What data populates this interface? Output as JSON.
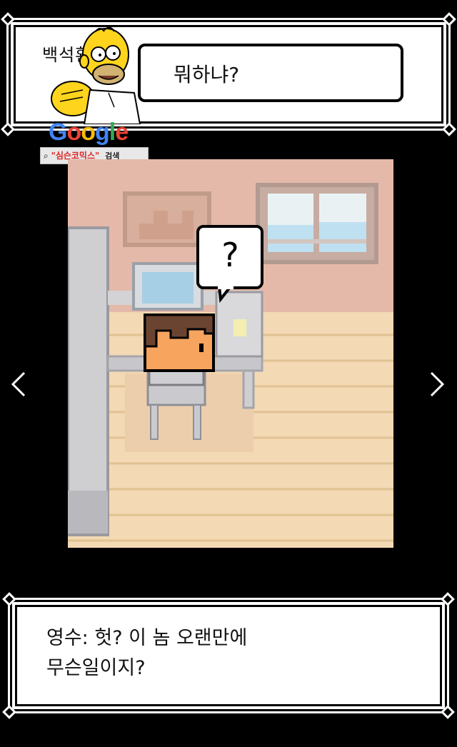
{
  "top_dialog": {
    "speaker": "백석환",
    "speech": "뭐하냐?"
  },
  "watermark": {
    "google_letters": [
      {
        "char": "G",
        "color": "#4285f4"
      },
      {
        "char": "o",
        "color": "#ea4335"
      },
      {
        "char": "o",
        "color": "#fbbc05"
      },
      {
        "char": "g",
        "color": "#4285f4"
      },
      {
        "char": "l",
        "color": "#34a853"
      },
      {
        "char": "e",
        "color": "#ea4335"
      }
    ],
    "search_term": "\"심슨코믹스\"",
    "search_button": "검색"
  },
  "scene": {
    "thought_bubble": "?"
  },
  "navigation": {
    "prev": "‹",
    "next": "›"
  },
  "bottom_dialog": {
    "line1": "영수: 헛? 이 놈 오랜만에",
    "line2": "무슨일이지?"
  }
}
